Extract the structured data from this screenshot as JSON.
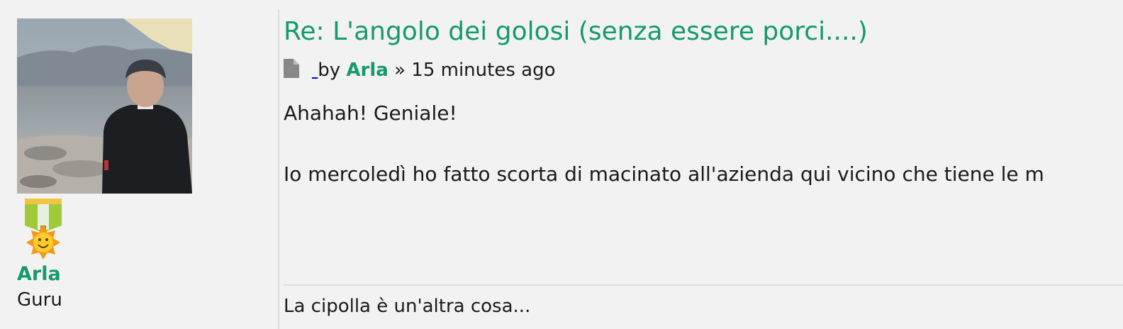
{
  "profile": {
    "username": "Arla",
    "rank_title": "Guru",
    "username_color": "#159a6b"
  },
  "post": {
    "title": "Re: L'angolo dei golosi (senza essere porci....)",
    "meta": {
      "by_label": "by",
      "author": "Arla",
      "separator": "»",
      "time": "15 minutes ago",
      "icon": "file-icon"
    },
    "content": [
      "Ahahah! Geniale!",
      "Io mercoledì ho fatto scorta di macinato all'azienda qui vicino che tiene le m"
    ],
    "signature": "La cipolla è un'altra cosa..."
  },
  "colors": {
    "accent": "#159a6b",
    "background": "#f2f2f2",
    "divider": "#dcdcdc"
  }
}
